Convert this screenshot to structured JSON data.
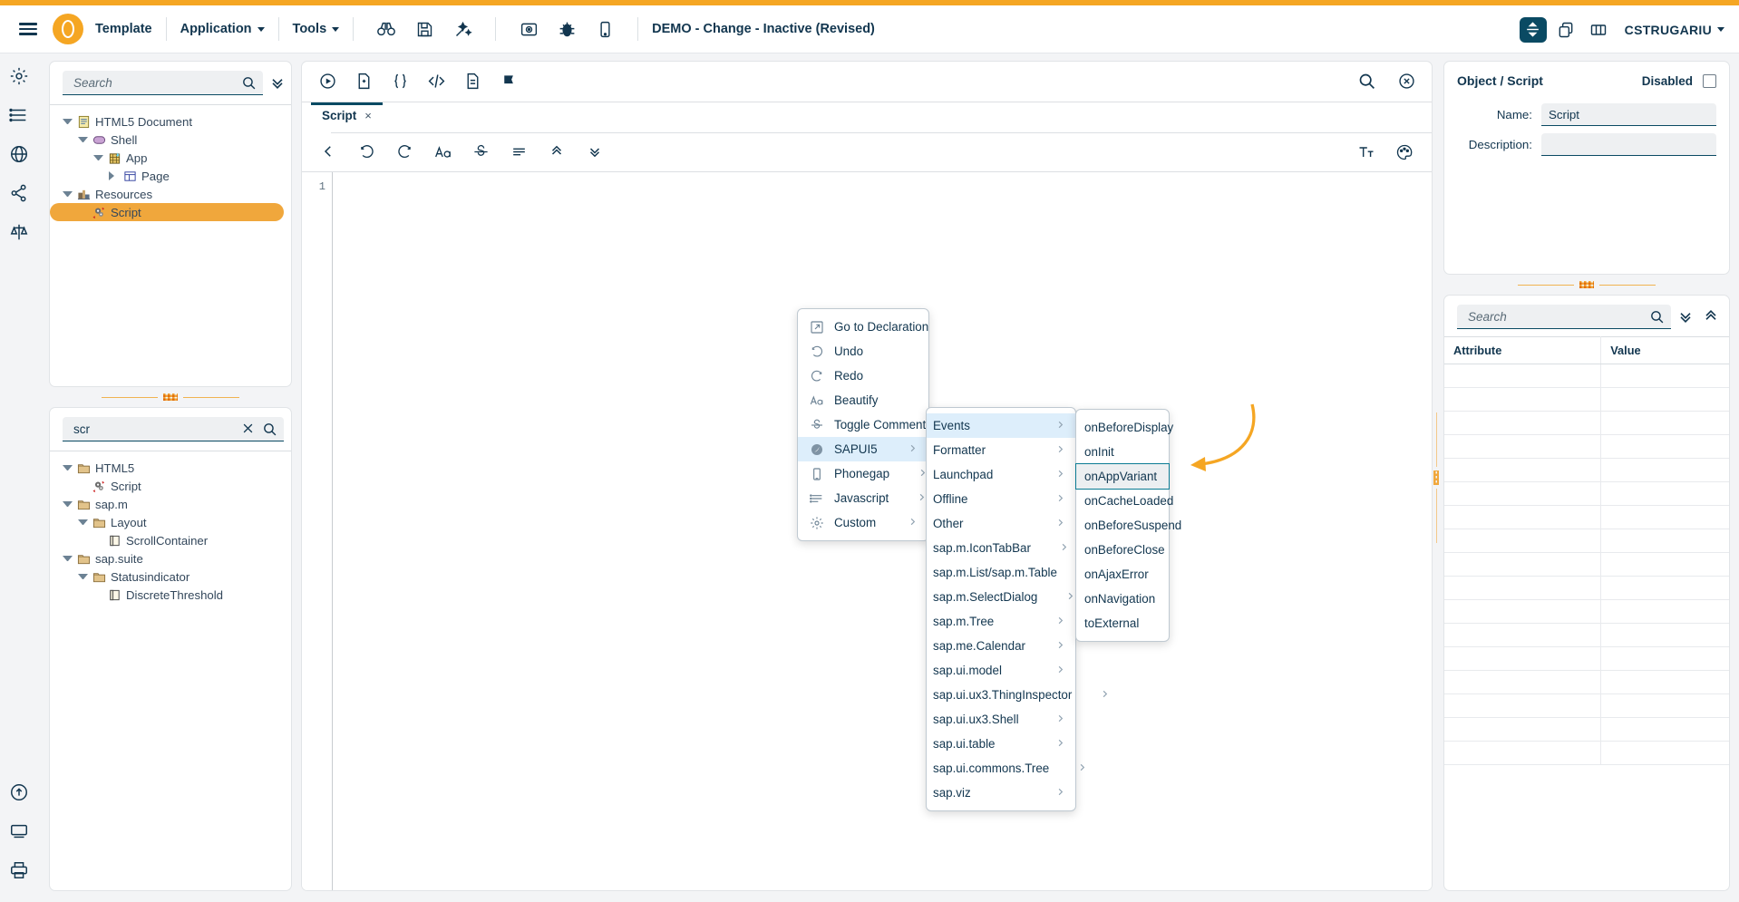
{
  "header": {
    "brand_label": "Template",
    "menus": [
      {
        "label": "Application"
      },
      {
        "label": "Tools"
      }
    ],
    "tool_icons": [
      "binoculars-icon",
      "save-icon",
      "wand-icon",
      "deploy-icon",
      "debug-icon",
      "mobile-preview-icon"
    ],
    "document_title": "DEMO - Change - Inactive (Revised)",
    "right_icons": [
      "layout-split-icon",
      "copy-icon",
      "columns-icon"
    ],
    "user": "CSTRUGARIU",
    "accent_color": "#f5a623"
  },
  "rail": {
    "icons": [
      "settings-gear-icon",
      "list-icon",
      "globe-icon",
      "share-icon",
      "balance-icon"
    ],
    "bottom_icons": [
      "publish-icon",
      "layers-icon",
      "print-icon"
    ]
  },
  "left": {
    "tree_top": {
      "search": {
        "value": "",
        "placeholder": "Search"
      },
      "items": [
        {
          "label": "HTML5 Document",
          "indent": 0,
          "twisty": "open",
          "icon": "document-icon",
          "selected": false
        },
        {
          "label": "Shell",
          "indent": 1,
          "twisty": "open",
          "icon": "shell-icon",
          "selected": false
        },
        {
          "label": "App",
          "indent": 2,
          "twisty": "open",
          "icon": "app-icon",
          "selected": false
        },
        {
          "label": "Page",
          "indent": 3,
          "twisty": "closed",
          "icon": "page-icon",
          "selected": false
        },
        {
          "label": "Resources",
          "indent": 0,
          "twisty": "open",
          "icon": "resources-icon",
          "selected": false
        },
        {
          "label": "Script",
          "indent": 1,
          "twisty": "none",
          "icon": "script-icon",
          "selected": true
        }
      ]
    },
    "tree_bottom": {
      "search": {
        "value": "scr",
        "placeholder": "Search"
      },
      "items": [
        {
          "label": "HTML5",
          "indent": 0,
          "twisty": "open",
          "icon": "folder-icon",
          "selected": false
        },
        {
          "label": "Script",
          "indent": 1,
          "twisty": "none",
          "icon": "script-icon",
          "selected": false
        },
        {
          "label": "sap.m",
          "indent": 0,
          "twisty": "open",
          "icon": "folder-icon",
          "selected": false
        },
        {
          "label": "Layout",
          "indent": 1,
          "twisty": "open",
          "icon": "folder-icon",
          "selected": false
        },
        {
          "label": "ScrollContainer",
          "indent": 2,
          "twisty": "none",
          "icon": "control-icon",
          "selected": false
        },
        {
          "label": "sap.suite",
          "indent": 0,
          "twisty": "open",
          "icon": "folder-icon",
          "selected": false
        },
        {
          "label": "Statusindicator",
          "indent": 1,
          "twisty": "open",
          "icon": "folder-icon",
          "selected": false
        },
        {
          "label": "DiscreteThreshold",
          "indent": 2,
          "twisty": "none",
          "icon": "control-icon",
          "selected": false
        }
      ]
    }
  },
  "editor": {
    "toolbar_icons": [
      "run-icon",
      "preview-file-icon",
      "braces-icon",
      "code-tag-icon",
      "file-icon",
      "flag-icon"
    ],
    "toolbar_right_icons": [
      "search-icon",
      "close-circle-icon"
    ],
    "tab": {
      "name": "Script",
      "close": "×"
    },
    "format_icons": [
      "back-icon",
      "undo-icon",
      "redo-icon",
      "font-case-icon",
      "strikethrough-icon",
      "lines-icon",
      "collapse-up-icon",
      "expand-down-icon"
    ],
    "format_right_icons": [
      "text-format-icon",
      "palette-icon"
    ],
    "line_numbers": [
      "1"
    ],
    "code": ""
  },
  "context_menu": {
    "main": [
      {
        "label": "Go to Declaration",
        "icon": "goto-declaration-icon",
        "arrow": false,
        "highlight": false
      },
      {
        "label": "Undo",
        "icon": "undo-icon",
        "arrow": false,
        "highlight": false
      },
      {
        "label": "Redo",
        "icon": "redo-icon",
        "arrow": false,
        "highlight": false
      },
      {
        "label": "Beautify",
        "icon": "font-case-icon",
        "arrow": false,
        "highlight": false
      },
      {
        "label": "Toggle Comment",
        "icon": "strikethrough-icon",
        "arrow": false,
        "highlight": false
      },
      {
        "label": "SAPUI5",
        "icon": "sapui5-icon",
        "arrow": true,
        "highlight": true
      },
      {
        "label": "Phonegap",
        "icon": "phonegap-icon",
        "arrow": true,
        "highlight": false
      },
      {
        "label": "Javascript",
        "icon": "javascript-icon",
        "arrow": true,
        "highlight": false
      },
      {
        "label": "Custom",
        "icon": "custom-gear-icon",
        "arrow": true,
        "highlight": false
      }
    ],
    "sapui5_submenu": [
      {
        "label": "Events",
        "arrow": true,
        "highlight": true
      },
      {
        "label": "Formatter",
        "arrow": true,
        "highlight": false
      },
      {
        "label": "Launchpad",
        "arrow": true,
        "highlight": false
      },
      {
        "label": "Offline",
        "arrow": true,
        "highlight": false
      },
      {
        "label": "Other",
        "arrow": true,
        "highlight": false
      },
      {
        "label": "sap.m.IconTabBar",
        "arrow": true,
        "highlight": false
      },
      {
        "label": "sap.m.List/sap.m.Table",
        "arrow": true,
        "highlight": false
      },
      {
        "label": "sap.m.SelectDialog",
        "arrow": true,
        "highlight": false
      },
      {
        "label": "sap.m.Tree",
        "arrow": true,
        "highlight": false
      },
      {
        "label": "sap.me.Calendar",
        "arrow": true,
        "highlight": false
      },
      {
        "label": "sap.ui.model",
        "arrow": true,
        "highlight": false
      },
      {
        "label": "sap.ui.ux3.ThingInspector",
        "arrow": true,
        "highlight": false
      },
      {
        "label": "sap.ui.ux3.Shell",
        "arrow": true,
        "highlight": false
      },
      {
        "label": "sap.ui.table",
        "arrow": true,
        "highlight": false
      },
      {
        "label": "sap.ui.commons.Tree",
        "arrow": true,
        "highlight": false
      },
      {
        "label": "sap.viz",
        "arrow": true,
        "highlight": false
      }
    ],
    "events_submenu": [
      {
        "label": "onBeforeDisplay",
        "boxed": false
      },
      {
        "label": "onInit",
        "boxed": false
      },
      {
        "label": "onAppVariant",
        "boxed": true
      },
      {
        "label": "onCacheLoaded",
        "boxed": false
      },
      {
        "label": "onBeforeSuspend",
        "boxed": false
      },
      {
        "label": "onBeforeClose",
        "boxed": false
      },
      {
        "label": "onAjaxError",
        "boxed": false
      },
      {
        "label": "onNavigation",
        "boxed": false
      },
      {
        "label": "toExternal",
        "boxed": false
      }
    ]
  },
  "right": {
    "object_panel": {
      "title": "Object / Script",
      "disabled_label": "Disabled",
      "disabled_checked": false,
      "fields": [
        {
          "label": "Name:",
          "value": "Script"
        },
        {
          "label": "Description:",
          "value": ""
        }
      ]
    },
    "attributes_panel": {
      "search": {
        "value": "",
        "placeholder": "Search"
      },
      "columns": [
        "Attribute",
        "Value"
      ],
      "rows": []
    }
  },
  "annotation": {
    "arrow_color": "#f5a623"
  }
}
